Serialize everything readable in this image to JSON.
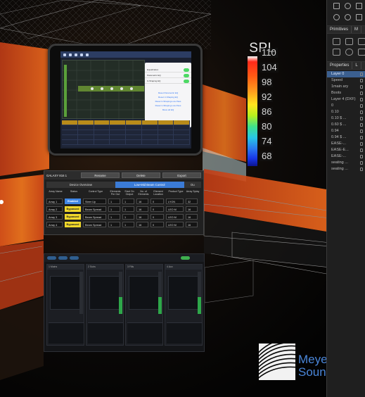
{
  "side_panel": {
    "tabs": [
      "Primitives",
      "M"
    ],
    "properties_tab": "Properties",
    "properties_tab2": "L",
    "layers": [
      {
        "label": "Layer 0",
        "selected": true
      },
      {
        "label": "Speed",
        "selected": false
      },
      {
        "label": "1main ary",
        "selected": false
      },
      {
        "label": "Boots",
        "selected": false
      },
      {
        "label": "Layer 4 (DXF)",
        "selected": false
      },
      {
        "label": "0",
        "selected": false
      },
      {
        "label": "0.10",
        "selected": false
      },
      {
        "label": "0.10 $ ...",
        "selected": false
      },
      {
        "label": "0.60 $ ...",
        "selected": false
      },
      {
        "label": "0.94",
        "selected": false
      },
      {
        "label": "0.94 $ ...",
        "selected": false
      },
      {
        "label": "EASE-...",
        "selected": false
      },
      {
        "label": "EASE-E...",
        "selected": false
      },
      {
        "label": "EASE-...",
        "selected": false
      },
      {
        "label": "seating ...",
        "selected": false
      },
      {
        "label": "seating ...",
        "selected": false
      }
    ]
  },
  "spl_legend": {
    "title": "SPL",
    "ticks": [
      "110",
      "104",
      "98",
      "92",
      "86",
      "80",
      "74",
      "68"
    ]
  },
  "dialog": {
    "title": "GALAXY 816 1",
    "buttons": [
      "Rename",
      "Delete",
      "Export"
    ],
    "tabs": [
      "Device Overview",
      "Low-Mid Beam Control",
      "Ou"
    ],
    "columns": [
      "Array Name",
      "Status",
      "Control Type",
      "Elements Per Out",
      "Start On Output",
      "No. of Elements",
      "Element Location",
      "Product Type",
      "Array Splay"
    ],
    "rows": [
      {
        "name": "Array 1",
        "status": "Enabled",
        "status_on": true,
        "control": "Steer Up",
        "epo": "1",
        "start": "1",
        "count": "16",
        "loc": "0",
        "product": "LYON",
        "splay": "32"
      },
      {
        "name": "Array 2",
        "status": "Bypassed",
        "status_on": false,
        "control": "Beam Spread",
        "epo": "1",
        "start": "1",
        "count": "16",
        "loc": "0",
        "product": "LEO M",
        "splay": "16"
      },
      {
        "name": "Array 3",
        "status": "Bypassed",
        "status_on": false,
        "control": "Beam Spread",
        "epo": "1",
        "start": "1",
        "count": "16",
        "loc": "0",
        "product": "LEO M",
        "splay": "16"
      },
      {
        "name": "Array 4",
        "status": "Bypassed",
        "status_on": false,
        "control": "Beam Spread",
        "epo": "1",
        "start": "1",
        "count": "16",
        "loc": "0",
        "product": "LEO M",
        "splay": "16"
      }
    ]
  },
  "ipad_menu": {
    "toggles": [
      "Equalization",
      "Parametric EQ",
      "U-Shaping EQ"
    ],
    "links": [
      "Reset Parametric EQ",
      "Reset U-Shaping EQ",
      "Reset U-Shaping-Low Pass",
      "Reset U-Shaping Low Pass",
      "Move all EQ"
    ]
  },
  "console": {
    "channels": [
      "1 Mains",
      "2 Subs",
      "3 Fills",
      "4 Aux"
    ]
  },
  "logo": {
    "line1": "Meyer",
    "line2": "Sound",
    "accent": "#4a86d9"
  }
}
